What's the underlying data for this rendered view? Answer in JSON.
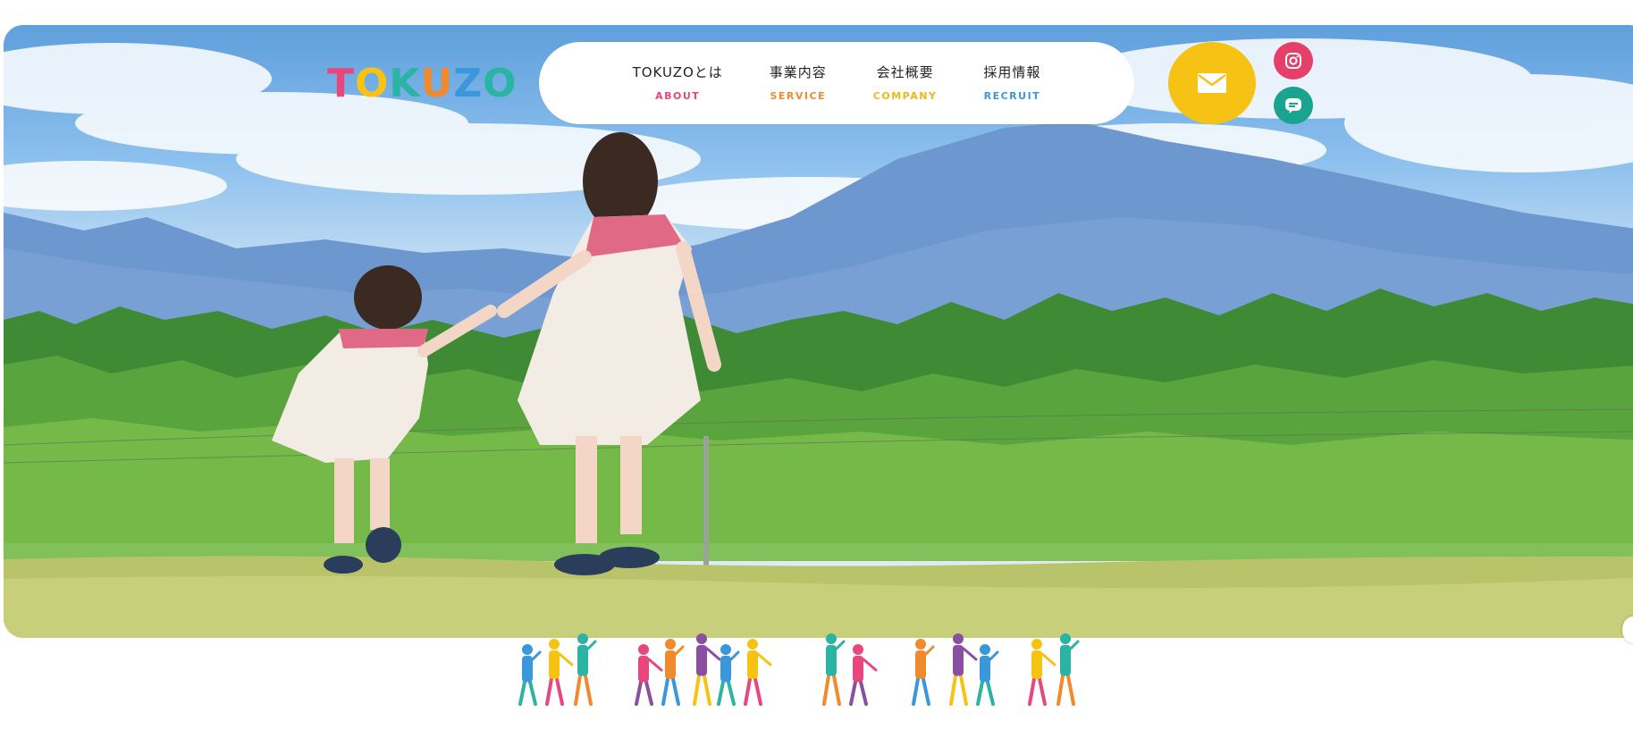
{
  "brand": {
    "logo_letters": [
      "T",
      "O",
      "K",
      "U",
      "Z",
      "O"
    ],
    "logo_colors": [
      "#e8467c",
      "#f6c314",
      "#2bb3a3",
      "#f18a2c",
      "#3a97d9",
      "#2bb3a3"
    ]
  },
  "nav": {
    "items": [
      {
        "jp": "TOKUZOとは",
        "en": "ABOUT",
        "color": "#e8467c"
      },
      {
        "jp": "事業内容",
        "en": "SERVICE",
        "color": "#f18a2c"
      },
      {
        "jp": "会社概要",
        "en": "COMPANY",
        "color": "#f2b70f"
      },
      {
        "jp": "採用情報",
        "en": "RECRUIT",
        "color": "#3a97d9"
      }
    ]
  },
  "actions": {
    "mail_icon": "mail-envelope-icon",
    "mail_color": "#f6c314",
    "instagram_icon": "instagram-icon",
    "instagram_color": "#e4406a",
    "line_icon": "line-chat-icon",
    "line_color": "#1aa38f"
  },
  "hero": {
    "image_icon": "hero-photo-children-on-hill"
  },
  "decor": {
    "people_icon": "walking-people-illustration",
    "palette": [
      "#3a97d9",
      "#f6c314",
      "#2bb3a3",
      "#e8467c",
      "#f18a2c",
      "#8a4fa0"
    ]
  }
}
